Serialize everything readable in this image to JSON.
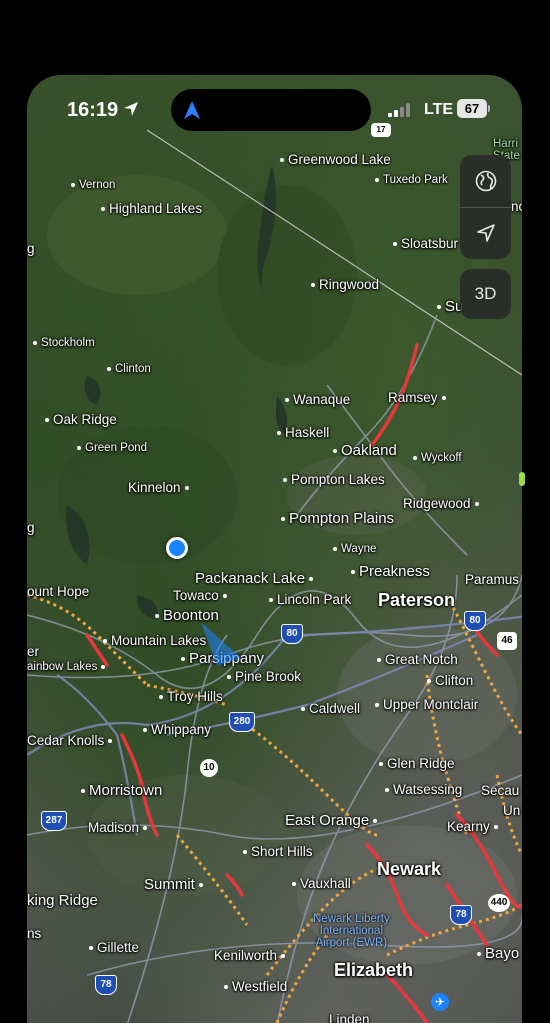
{
  "status_bar": {
    "time": "16:19",
    "network": "LTE",
    "battery": "67"
  },
  "controls": {
    "globe_icon": "globe-icon",
    "locate_icon": "location-arrow-icon",
    "three_d_label": "3D"
  },
  "places": [
    {
      "id": "greenwood-lake",
      "name": "Greenwood Lake",
      "size": "s2",
      "dot": "before"
    },
    {
      "id": "harriman",
      "name": "Harri",
      "size": "s1",
      "dot": "none"
    },
    {
      "id": "harriman-state",
      "name": "State",
      "size": "s1",
      "dot": "none"
    },
    {
      "id": "vernon",
      "name": "Vernon",
      "size": "s1",
      "dot": "before"
    },
    {
      "id": "tuxedo-park",
      "name": "Tuxedo Park",
      "size": "s1",
      "dot": "before"
    },
    {
      "id": "highland-lakes",
      "name": "Highland Lakes",
      "size": "s2",
      "dot": "before"
    },
    {
      "id": "sloatsburg",
      "name": "Sloatsbur",
      "size": "s2",
      "dot": "before"
    },
    {
      "id": "ringwood",
      "name": "Ringwood",
      "size": "s2",
      "dot": "before"
    },
    {
      "id": "suffern",
      "name": "Su",
      "size": "s3",
      "dot": "before"
    },
    {
      "id": "stockholm",
      "name": "Stockholm",
      "size": "s1",
      "dot": "before"
    },
    {
      "id": "clinton",
      "name": "Clinton",
      "size": "s1",
      "dot": "before"
    },
    {
      "id": "wanaque",
      "name": "Wanaque",
      "size": "s2",
      "dot": "before"
    },
    {
      "id": "ramsey",
      "name": "Ramsey",
      "size": "s2",
      "dot": "after"
    },
    {
      "id": "oak-ridge",
      "name": "Oak Ridge",
      "size": "s2",
      "dot": "before"
    },
    {
      "id": "haskell",
      "name": "Haskell",
      "size": "s2",
      "dot": "before"
    },
    {
      "id": "green-pond",
      "name": "Green Pond",
      "size": "s1",
      "dot": "before"
    },
    {
      "id": "oakland",
      "name": "Oakland",
      "size": "s3",
      "dot": "before"
    },
    {
      "id": "wyckoff",
      "name": "Wyckoff",
      "size": "s1",
      "dot": "before"
    },
    {
      "id": "pompton-lakes",
      "name": "Pompton Lakes",
      "size": "s2",
      "dot": "before"
    },
    {
      "id": "kinnelon",
      "name": "Kinnelon",
      "size": "s2",
      "dot": "after"
    },
    {
      "id": "ridgewood",
      "name": "Ridgewood",
      "size": "s2",
      "dot": "after"
    },
    {
      "id": "pompton-plains",
      "name": "Pompton Plains",
      "size": "s3",
      "dot": "before"
    },
    {
      "id": "wayne",
      "name": "Wayne",
      "size": "s1",
      "dot": "before"
    },
    {
      "id": "preakness",
      "name": "Preakness",
      "size": "s3",
      "dot": "before"
    },
    {
      "id": "packanack-lake",
      "name": "Packanack Lake",
      "size": "s3",
      "dot": "after"
    },
    {
      "id": "paramus",
      "name": "Paramus",
      "size": "s2",
      "dot": "none"
    },
    {
      "id": "mount-hope",
      "name": "ount Hope",
      "size": "s2",
      "dot": "none"
    },
    {
      "id": "towaco",
      "name": "Towaco",
      "size": "s2",
      "dot": "after"
    },
    {
      "id": "lincoln-park",
      "name": "Lincoln Park",
      "size": "s2",
      "dot": "before"
    },
    {
      "id": "paterson",
      "name": "Paterson",
      "size": "s4",
      "dot": "none"
    },
    {
      "id": "boonton",
      "name": "Boonton",
      "size": "s3",
      "dot": "before"
    },
    {
      "id": "mountain-lakes",
      "name": "Mountain Lakes",
      "size": "s2",
      "dot": "before"
    },
    {
      "id": "parsippany",
      "name": "Parsippany",
      "size": "s3",
      "dot": "before"
    },
    {
      "id": "great-notch",
      "name": "Great Notch",
      "size": "s2",
      "dot": "before"
    },
    {
      "id": "rainbow-lakes",
      "name": "ainbow Lakes",
      "size": "s1",
      "dot": "after"
    },
    {
      "id": "pine-brook",
      "name": "Pine Brook",
      "size": "s2",
      "dot": "before"
    },
    {
      "id": "clifton",
      "name": "Clifton",
      "size": "s2",
      "dot": "before"
    },
    {
      "id": "troy-hills",
      "name": "Troy Hills",
      "size": "s2",
      "dot": "before"
    },
    {
      "id": "caldwell",
      "name": "Caldwell",
      "size": "s2",
      "dot": "before"
    },
    {
      "id": "upper-montclair",
      "name": "Upper Montclair",
      "size": "s2",
      "dot": "before"
    },
    {
      "id": "whippany",
      "name": "Whippany",
      "size": "s2",
      "dot": "before"
    },
    {
      "id": "cedar-knolls",
      "name": "Cedar Knolls",
      "size": "s2",
      "dot": "after"
    },
    {
      "id": "glen-ridge",
      "name": "Glen Ridge",
      "size": "s2",
      "dot": "before"
    },
    {
      "id": "morristown",
      "name": "Morristown",
      "size": "s3",
      "dot": "before"
    },
    {
      "id": "watsessing",
      "name": "Watsessing",
      "size": "s2",
      "dot": "before"
    },
    {
      "id": "secaucus",
      "name": "Secau",
      "size": "s2",
      "dot": "none"
    },
    {
      "id": "union-city",
      "name": "Un",
      "size": "s2",
      "dot": "none"
    },
    {
      "id": "madison",
      "name": "Madison",
      "size": "s2",
      "dot": "after"
    },
    {
      "id": "east-orange",
      "name": "East Orange",
      "size": "s3",
      "dot": "after"
    },
    {
      "id": "kearny",
      "name": "Kearny",
      "size": "s2",
      "dot": "after"
    },
    {
      "id": "short-hills",
      "name": "Short Hills",
      "size": "s2",
      "dot": "before"
    },
    {
      "id": "summit",
      "name": "Summit",
      "size": "s3",
      "dot": "after"
    },
    {
      "id": "vauxhall",
      "name": "Vauxhall",
      "size": "s2",
      "dot": "before"
    },
    {
      "id": "newark",
      "name": "Newark",
      "size": "s4",
      "dot": "none"
    },
    {
      "id": "basking-ridge",
      "name": "king Ridge",
      "size": "s3",
      "dot": "none"
    },
    {
      "id": "berkeley-heights",
      "name": "ns",
      "size": "s2",
      "dot": "none"
    },
    {
      "id": "gillette",
      "name": "Gillette",
      "size": "s2",
      "dot": "before"
    },
    {
      "id": "kenilworth",
      "name": "Kenilworth",
      "size": "s2",
      "dot": "after"
    },
    {
      "id": "bayonne",
      "name": "Bayo",
      "size": "s3",
      "dot": "before"
    },
    {
      "id": "elizabeth",
      "name": "Elizabeth",
      "size": "s4",
      "dot": "none"
    },
    {
      "id": "westfield",
      "name": "Westfield",
      "size": "s2",
      "dot": "before"
    },
    {
      "id": "linden",
      "name": "Linden",
      "size": "s2",
      "dot": "none"
    },
    {
      "id": "dover",
      "name": "er",
      "size": "s2",
      "dot": "none"
    },
    {
      "id": "g-edge",
      "name": "g",
      "size": "s2",
      "dot": "none"
    },
    {
      "id": "g-edge2",
      "name": "g",
      "size": "s2",
      "dot": "none"
    },
    {
      "id": "suffern-edge",
      "name": "no",
      "size": "s2",
      "dot": "none"
    }
  ],
  "airport": {
    "line1": "Newark Liberty",
    "line2": "International",
    "line3": "Airport (EWR)"
  },
  "shields": [
    {
      "id": "i80-a",
      "label": "80",
      "kind": "interstate"
    },
    {
      "id": "i80-b",
      "label": "80",
      "kind": "interstate"
    },
    {
      "id": "i280",
      "label": "280",
      "kind": "interstate"
    },
    {
      "id": "i287",
      "label": "287",
      "kind": "interstate"
    },
    {
      "id": "i78-a",
      "label": "78",
      "kind": "interstate"
    },
    {
      "id": "i78-b",
      "label": "78",
      "kind": "interstate"
    },
    {
      "id": "rt10",
      "label": "10",
      "kind": "state"
    },
    {
      "id": "rt440",
      "label": "440",
      "kind": "state"
    },
    {
      "id": "us46",
      "label": "46",
      "kind": "us"
    },
    {
      "id": "rt17",
      "label": "17",
      "kind": "us"
    }
  ]
}
